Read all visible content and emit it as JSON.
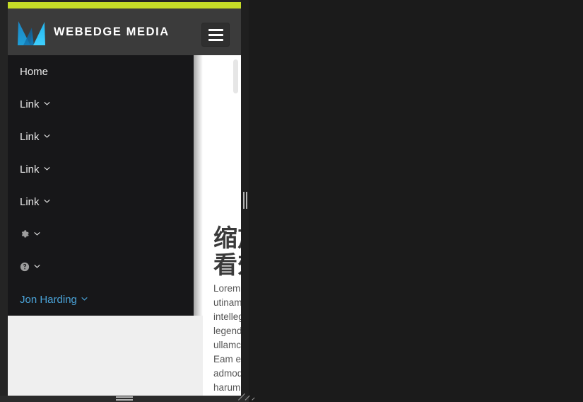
{
  "window": {
    "backdrop_color": "#1b1b1b",
    "frame_color": "#242424",
    "viewport_width_label": "",
    "accent_color": "#c5dc27"
  },
  "header": {
    "background_color": "#3b3b3b",
    "brand_name": "WEBEDGE MEDIA",
    "logo_icon": "webedge-mountain-logo",
    "logo_colors": [
      "#1fa8e0",
      "#1566a8",
      "#2bc4f2"
    ],
    "nav_toggle_icon": "hamburger-menu-icon",
    "nav_toggle_label": "Toggle navigation"
  },
  "nav": {
    "background_color": "#171719",
    "items": [
      {
        "label": "Home",
        "icon": null,
        "caret": false,
        "accent": false
      },
      {
        "label": "Link",
        "icon": null,
        "caret": true,
        "accent": false
      },
      {
        "label": "Link",
        "icon": null,
        "caret": true,
        "accent": false
      },
      {
        "label": "Link",
        "icon": null,
        "caret": true,
        "accent": false
      },
      {
        "label": "Link",
        "icon": null,
        "caret": true,
        "accent": false
      },
      {
        "label": "",
        "icon": "gear-icon",
        "caret": true,
        "accent": false
      },
      {
        "label": "",
        "icon": "help-circle-icon",
        "caret": true,
        "accent": false
      },
      {
        "label": "Jon Harding",
        "icon": null,
        "caret": true,
        "accent": true
      }
    ],
    "user_link_color": "#4aa3d8"
  },
  "page": {
    "background_color": "#ffffff",
    "lower_fill_color": "#efefef",
    "hero_title": "缩放以\n看效果",
    "hero_body": "Lorem ipsum dolor sit amet, sed ad utinam iisque convenire, te qui dolor intellegat, eos et purto choro ex. Pri et legendos recteque, vel ut quot ullamcorper, ne mei munere detraxit. Eam eum nonumy invenire, choro admodum inani vel no. Eam reque harum inermis ea."
  },
  "scrollbar": {
    "thumb_color": "#e6e6e6"
  },
  "handles": {
    "right_handle_name": "resize-handle-horizontal",
    "bottom_handle_name": "resize-handle-vertical",
    "corner_handle_name": "resize-handle-corner"
  }
}
